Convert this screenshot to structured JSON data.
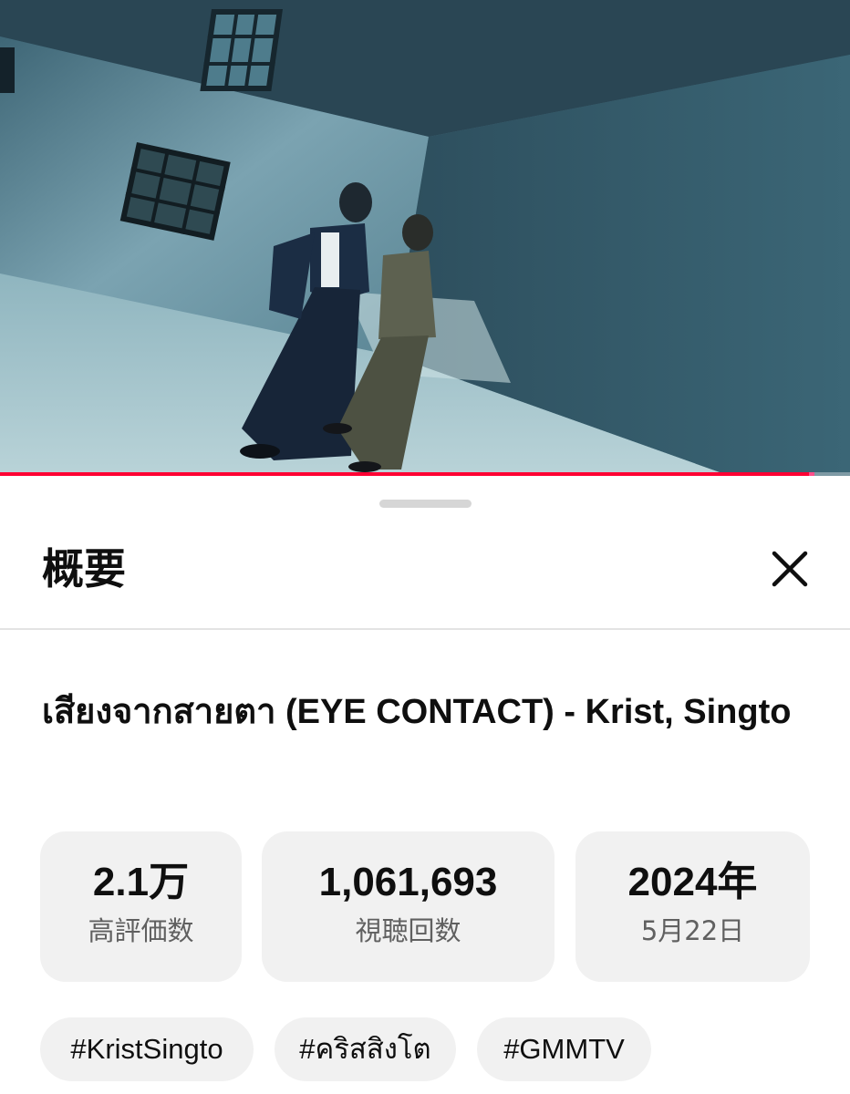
{
  "player": {
    "progress_fraction": 0.958,
    "colors": {
      "progress": "#ff0033",
      "progress_end": "#ff4d8a"
    }
  },
  "sheet": {
    "title": "概要",
    "close_icon": "close-icon"
  },
  "video": {
    "title": "เสียงจากสายตา (EYE CONTACT) - Krist, Singto"
  },
  "stats": [
    {
      "value": "2.1万",
      "label": "高評価数"
    },
    {
      "value": "1,061,693",
      "label": "視聴回数"
    },
    {
      "value": "2024年",
      "label": "5月22日"
    }
  ],
  "hashtags": [
    "#KristSingto",
    "#คริสสิงโต",
    "#GMMTV"
  ]
}
